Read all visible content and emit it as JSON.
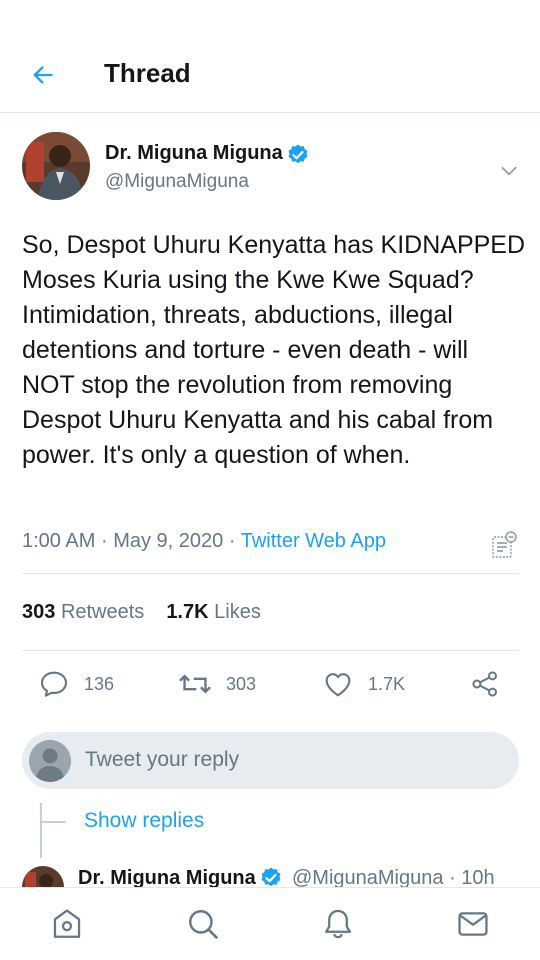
{
  "header": {
    "title": "Thread"
  },
  "tweet": {
    "author_name": "Dr. Miguna Miguna",
    "author_handle": "@MigunaMiguna",
    "text": "So, Despot Uhuru Kenyatta has KIDNAPPED Moses Kuria using the Kwe Kwe Squad? Intimidation, threats, abductions, illegal detentions and torture - even death - will NOT stop the revolution from removing Despot Uhuru Kenyatta and his cabal from power. It's only a question of when.",
    "time": "1:00 AM",
    "date": "May 9, 2020",
    "separator": "·",
    "source": "Twitter Web App"
  },
  "stats": {
    "retweets_count": "303",
    "retweets_label": "Retweets",
    "likes_count": "1.7K",
    "likes_label": "Likes"
  },
  "actions": {
    "reply_count": "136",
    "retweet_count": "303",
    "like_count": "1.7K"
  },
  "reply_box": {
    "placeholder": "Tweet your reply"
  },
  "show_replies": "Show replies",
  "next_tweet": {
    "author_name": "Dr. Miguna Miguna",
    "author_handle": "@MigunaMiguna",
    "separator": "·",
    "time_ago": "10h"
  },
  "icons": [
    "back-arrow-icon",
    "verified-badge-icon",
    "chevron-down-icon",
    "analytics-icon",
    "reply-icon",
    "retweet-icon",
    "like-icon",
    "share-icon",
    "home-icon",
    "search-icon",
    "notifications-icon",
    "messages-icon"
  ],
  "colors": {
    "accent": "#1da1f2",
    "text": "#14171a",
    "secondary": "#657786",
    "divider": "#e1e8ed"
  }
}
